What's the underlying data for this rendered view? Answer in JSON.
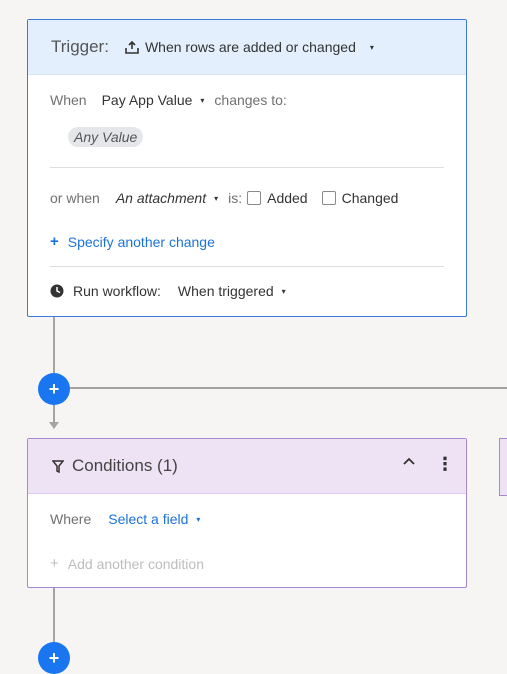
{
  "trigger": {
    "title": "Trigger:",
    "event_label": "When rows are added or changed",
    "when_label": "When",
    "column_label": "Pay App Value",
    "changes_to_label": "changes to:",
    "any_value_chip": "Any Value",
    "or_when_label": "or when",
    "attachment_label": "An attachment",
    "is_label": "is:",
    "added_label": "Added",
    "changed_label": "Changed",
    "specify_label": "Specify another change",
    "run_label": "Run workflow:",
    "run_value": "When triggered"
  },
  "conditions": {
    "title": "Conditions (1)",
    "where_label": "Where",
    "field_select": "Select a field",
    "add_condition": "Add another condition"
  },
  "icons": {
    "caret": "▾",
    "plus": "+",
    "chevron_up": "⌃",
    "more": "⋮"
  },
  "colors": {
    "trigger_border": "#3b7bd6",
    "trigger_header_bg": "#e3effd",
    "conditions_border": "#a987cf",
    "conditions_header_bg": "#ede3f4",
    "accent_blue": "#1976f0",
    "link_blue": "#1b73d9",
    "connector_gray": "#a3a3a3"
  }
}
